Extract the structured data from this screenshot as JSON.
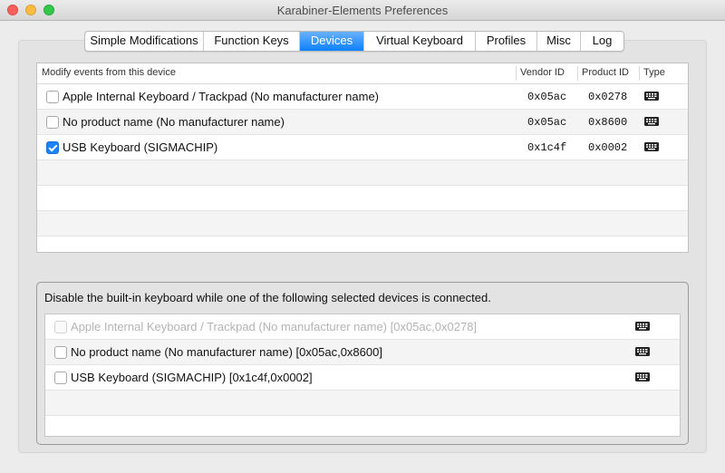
{
  "window": {
    "title": "Karabiner-Elements Preferences"
  },
  "tabs": [
    {
      "label": "Simple Modifications",
      "active": false
    },
    {
      "label": "Function Keys",
      "active": false
    },
    {
      "label": "Devices",
      "active": true
    },
    {
      "label": "Virtual Keyboard",
      "active": false
    },
    {
      "label": "Profiles",
      "active": false
    },
    {
      "label": "Misc",
      "active": false
    },
    {
      "label": "Log",
      "active": false
    }
  ],
  "devices_table": {
    "columns": {
      "name": "Modify events from this device",
      "vendor": "Vendor ID",
      "product": "Product ID",
      "type": "Type"
    },
    "rows": [
      {
        "name": "Apple Internal Keyboard / Trackpad (No manufacturer name)",
        "vendor_id": "0x05ac",
        "product_id": "0x0278",
        "checked": false,
        "type_icon": "keyboard-icon"
      },
      {
        "name": "No product name (No manufacturer name)",
        "vendor_id": "0x05ac",
        "product_id": "0x8600",
        "checked": false,
        "type_icon": "keyboard-icon"
      },
      {
        "name": "USB Keyboard (SIGMACHIP)",
        "vendor_id": "0x1c4f",
        "product_id": "0x0002",
        "checked": true,
        "type_icon": "keyboard-icon"
      }
    ]
  },
  "disable_builtin": {
    "label": "Disable the built-in keyboard while one of the following selected devices is connected.",
    "rows": [
      {
        "name": "Apple Internal Keyboard / Trackpad (No manufacturer name) [0x05ac,0x0278]",
        "checked": false,
        "disabled": true,
        "type_icon": "keyboard-icon"
      },
      {
        "name": "No product name (No manufacturer name) [0x05ac,0x8600]",
        "checked": false,
        "disabled": false,
        "type_icon": "keyboard-icon"
      },
      {
        "name": "USB Keyboard (SIGMACHIP) [0x1c4f,0x0002]",
        "checked": false,
        "disabled": false,
        "type_icon": "keyboard-icon"
      }
    ]
  },
  "colors": {
    "accent": "#0d81ff",
    "close": "#fc605c",
    "minimize": "#fdbc40",
    "zoom": "#34c84a"
  }
}
